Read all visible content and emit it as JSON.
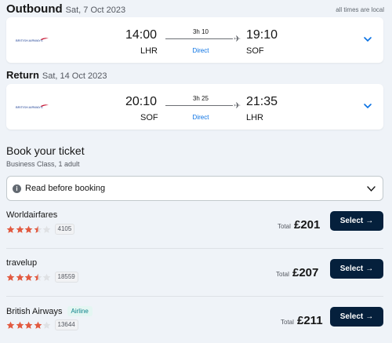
{
  "times_note": "all times are local",
  "outbound": {
    "title": "Outbound",
    "date": "Sat, 7 Oct 2023",
    "dep_time": "14:00",
    "dep_code": "LHR",
    "duration": "3h 10",
    "stops": "Direct",
    "arr_time": "19:10",
    "arr_code": "SOF",
    "logo_text": "BRITISH AIRWAYS"
  },
  "return": {
    "title": "Return",
    "date": "Sat, 14 Oct 2023",
    "dep_time": "20:10",
    "dep_code": "SOF",
    "duration": "3h 25",
    "stops": "Direct",
    "arr_time": "21:35",
    "arr_code": "LHR",
    "logo_text": "BRITISH AIRWAYS"
  },
  "booking": {
    "title": "Book your ticket",
    "subtitle": "Business Class, 1 adult",
    "read_before": "Read before booking"
  },
  "providers": [
    {
      "name": "Worldairfares",
      "tag": "",
      "rating": 3.5,
      "reviews": "4105",
      "total_label": "Total",
      "price": "£201",
      "select_label": "Select"
    },
    {
      "name": "travelup",
      "tag": "",
      "rating": 3.5,
      "reviews": "18559",
      "total_label": "Total",
      "price": "£207",
      "select_label": "Select"
    },
    {
      "name": "British Airways",
      "tag": "Airline",
      "rating": 4,
      "reviews": "13644",
      "total_label": "Total",
      "price": "£211",
      "select_label": "Select"
    }
  ],
  "colors": {
    "background": "#eff3f8",
    "accent_blue": "#0770e3",
    "button_dark": "#05203c",
    "star": "#e25a40",
    "airline_tag_text": "#0c838a"
  }
}
